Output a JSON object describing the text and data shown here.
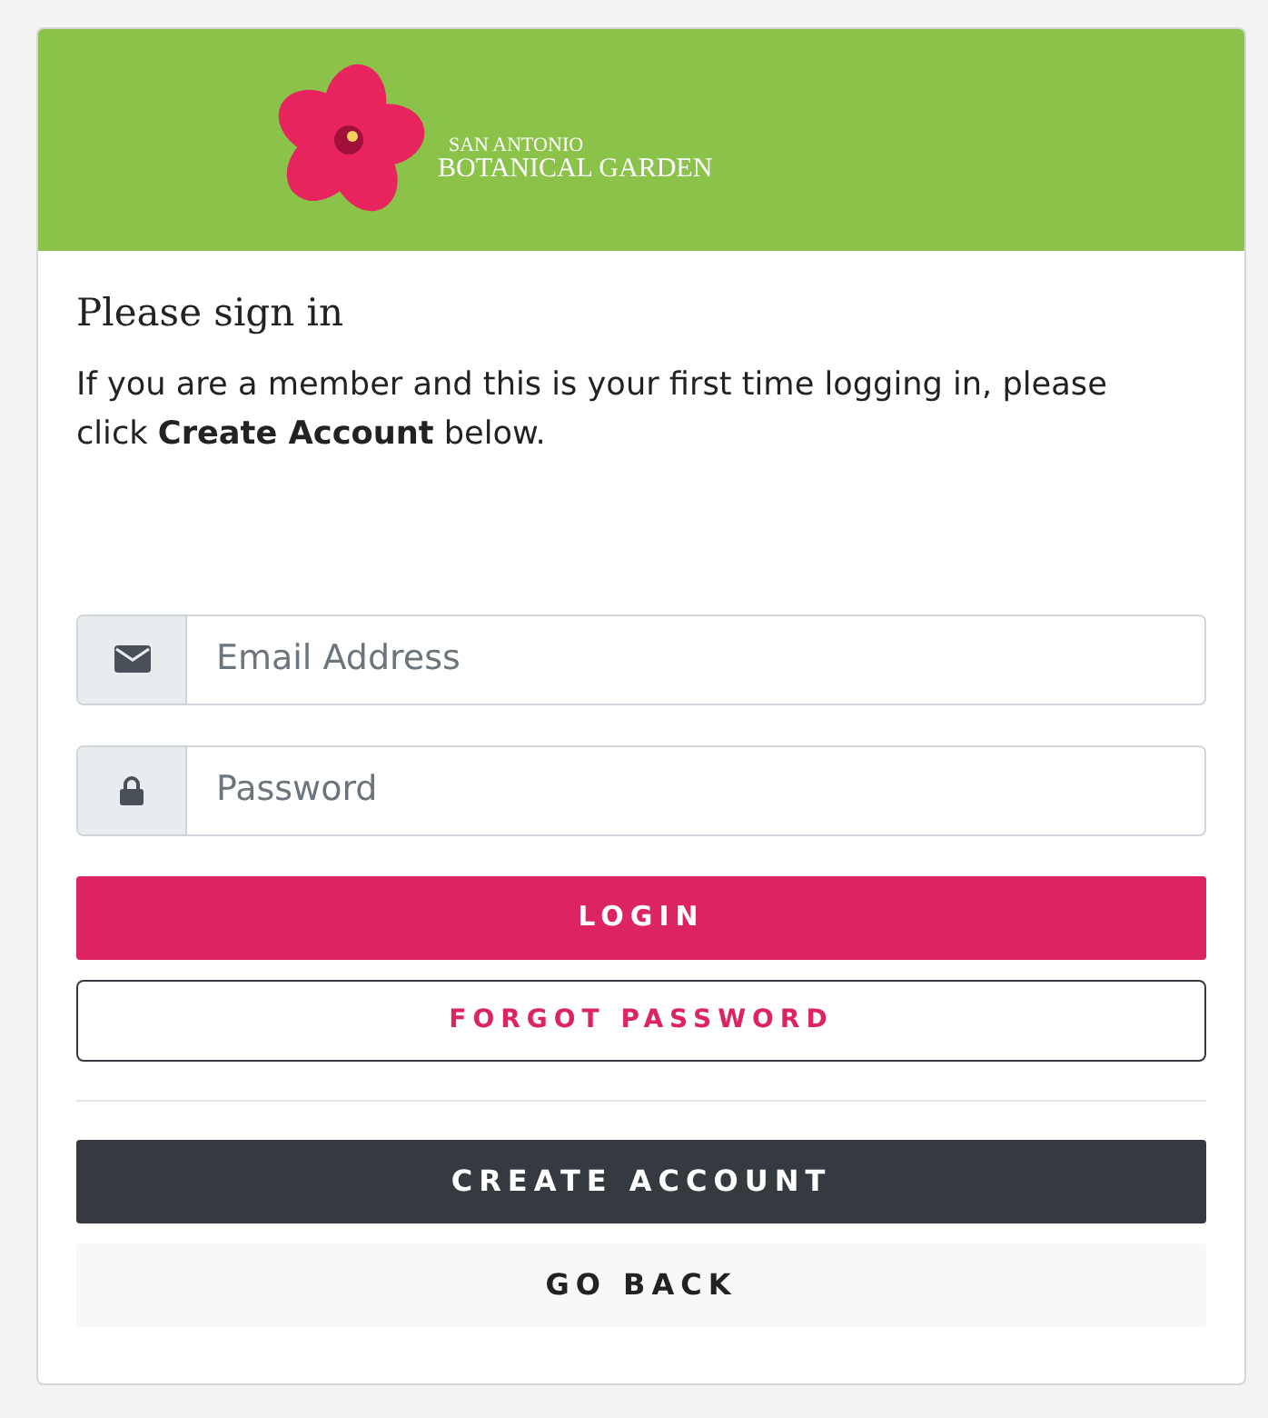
{
  "logo": {
    "line_1": "SAN ANTONIO",
    "line_2": "BOTANICAL GARDEN"
  },
  "heading": "Please sign in",
  "intro": "If you are a member and this is your first time logging in, please click **Create Account** below.",
  "fields": [
    {
      "kind": "email",
      "placeholder": "Email Address"
    },
    {
      "kind": "password",
      "placeholder": "Password"
    }
  ],
  "buttons": [
    {
      "label": "LOGIN",
      "kind": "primary"
    },
    {
      "label": "FORGOT PASSWORD",
      "kind": "outline"
    },
    {
      "label": "CREATE ACCOUNT",
      "kind": "dark",
      "divider_before": true
    },
    {
      "label": "GO BACK",
      "kind": "light"
    }
  ]
}
